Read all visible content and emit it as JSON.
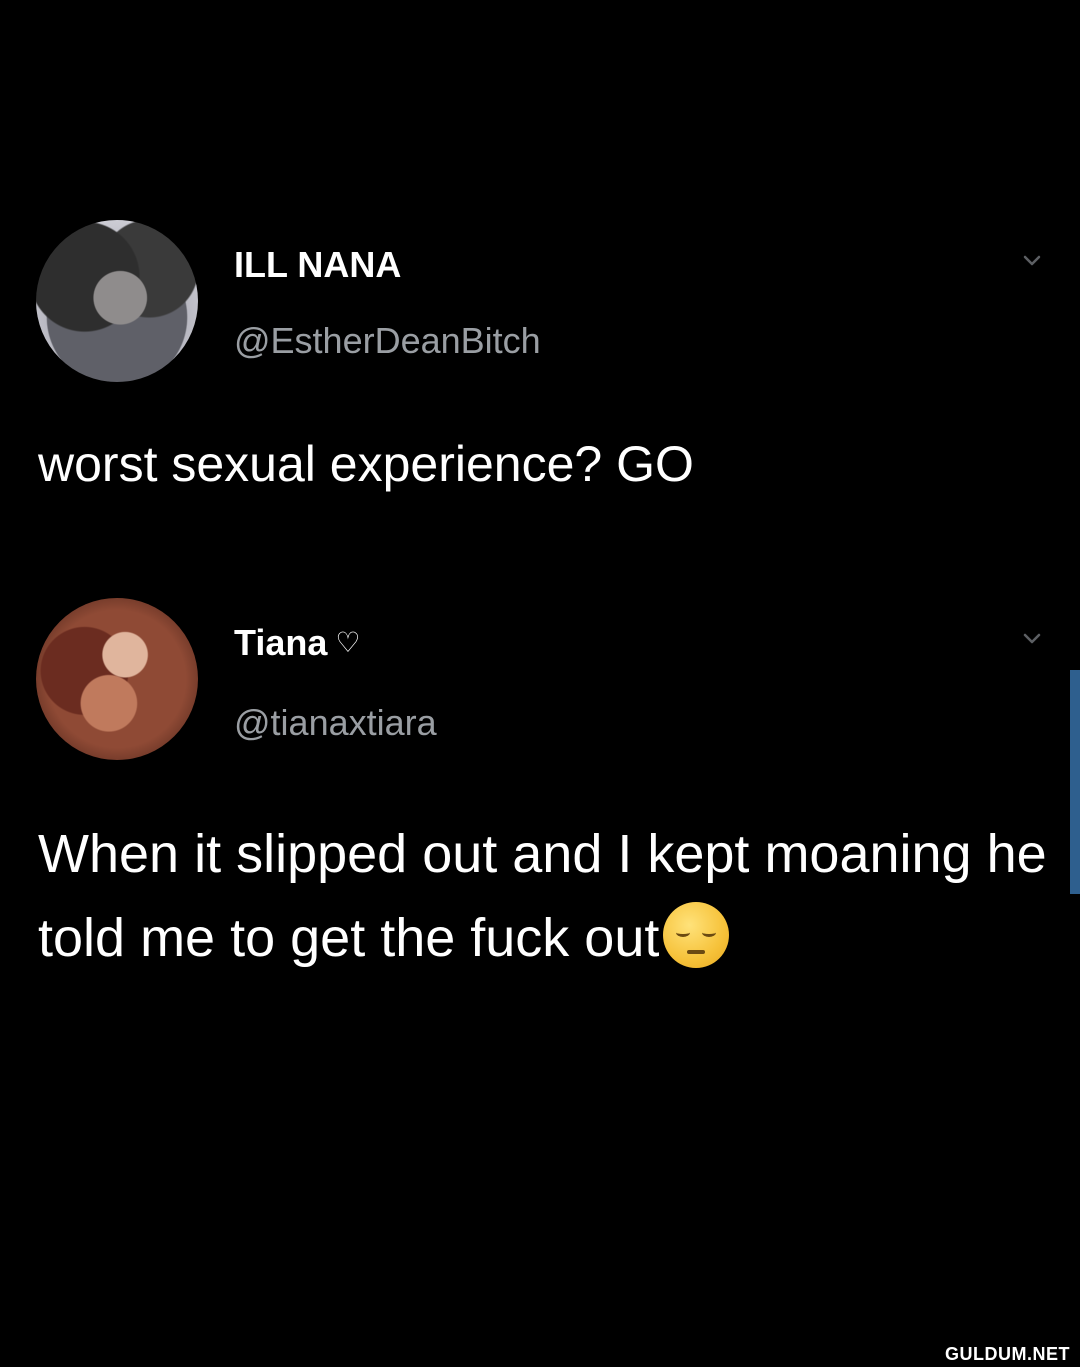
{
  "tweets": [
    {
      "display_name": "ILL NANA",
      "handle": "@EstherDeanBitch",
      "text": "worst sexual experience? GO",
      "avatar_icon": "profile-photo"
    },
    {
      "display_name": "Tiana",
      "name_badge": "♡",
      "handle": "@tianaxtiara",
      "text": "When it slipped out and I kept moaning he told me to get the fuck out",
      "emoji": "pensive-face",
      "avatar_icon": "profile-photo"
    }
  ],
  "icons": {
    "menu": "chevron-down-icon"
  },
  "colors": {
    "background": "#000000",
    "text": "#ffffff",
    "handle": "#9a9ea3",
    "scroll_indicator": "#2e5f8e"
  },
  "watermark": "GULDUM.NET"
}
